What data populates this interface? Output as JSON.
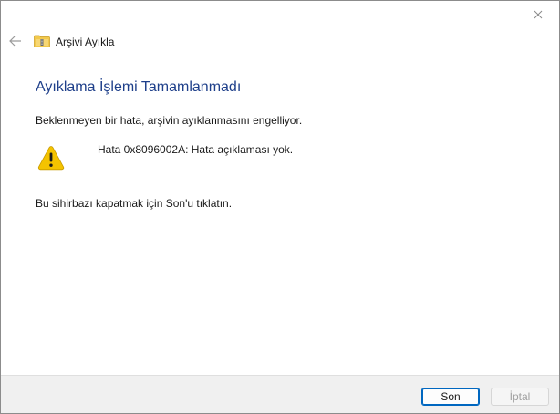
{
  "window": {
    "title": "Arşivi Ayıkla"
  },
  "page": {
    "heading": "Ayıklama İşlemi Tamamlanmadı",
    "message": "Beklenmeyen bir hata, arşivin ayıklanmasını engelliyor.",
    "error_code": "Hata 0x8096002A: Hata açıklaması yok.",
    "instruction": "Bu sihirbazı kapatmak için Son'u tıklatın."
  },
  "buttons": {
    "finish_label": "Son",
    "cancel_label": "İptal"
  },
  "icons": {
    "close": "close-icon",
    "back": "back-arrow-icon",
    "folder": "zip-folder-icon",
    "warning": "warning-icon"
  },
  "colors": {
    "heading": "#1e3f8a",
    "accent": "#0067c0",
    "warning": "#f4c300"
  }
}
